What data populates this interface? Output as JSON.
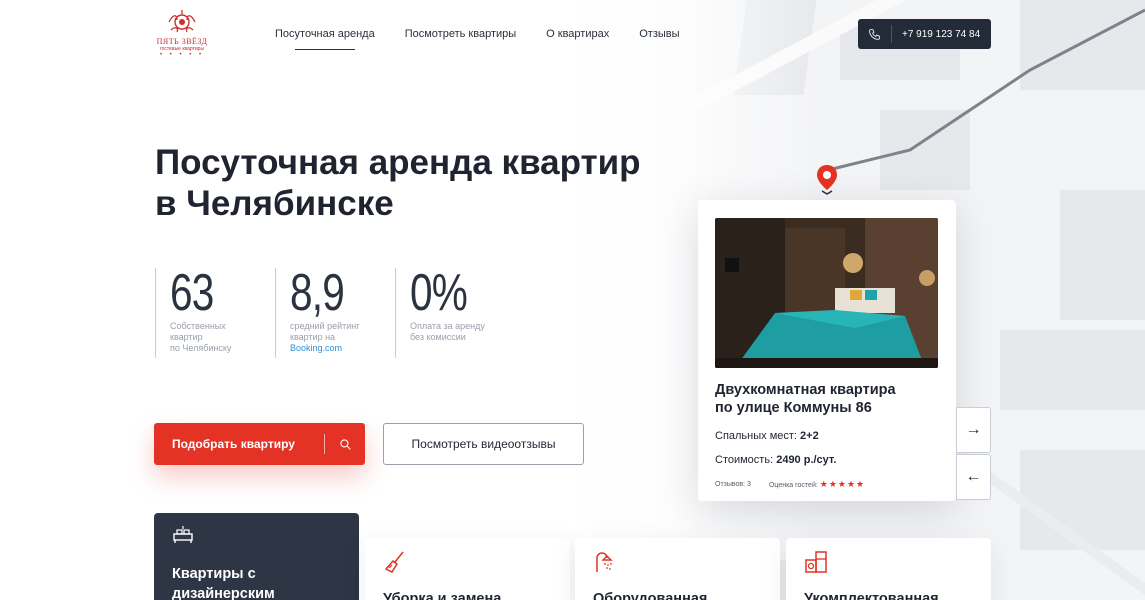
{
  "brand": {
    "name": "ПЯТЬ ЗВЁЗД",
    "tagline": "гостевые квартиры",
    "dots": "• • • • •",
    "accent_color": "#e43324"
  },
  "nav": {
    "items": [
      {
        "label": "Посуточная аренда",
        "active": true
      },
      {
        "label": "Посмотреть квартиры"
      },
      {
        "label": "О квартирах"
      },
      {
        "label": "Отзывы"
      }
    ]
  },
  "header": {
    "phone_icon": "phone-icon",
    "phone": "+7 919 123 74 84"
  },
  "hero": {
    "title_line1": "Посуточная аренда квартир",
    "title_line2": "в Челябинске",
    "stats": [
      {
        "value": "63",
        "caption": [
          "Собственных",
          "квартир",
          "по Челябинску"
        ]
      },
      {
        "value": "8,9",
        "caption": [
          "средний рейтинг",
          "квартир на"
        ],
        "link": "Booking.com"
      },
      {
        "value": "0%",
        "caption": [
          "Оплата за аренду",
          "без комиссии"
        ]
      }
    ],
    "primary_button": "Подобрать квартиру",
    "secondary_button": "Посмотреть видеоотзывы"
  },
  "property": {
    "title_line1": "Двухкомнатная квартира",
    "title_line2": "по улице Коммуны 86",
    "beds_label": "Спальных мест:",
    "beds_value": "2+2",
    "price_label": "Стоимость:",
    "price_value": "2490 р./сут.",
    "reviews": "Отзывов: 3",
    "rating_label": "Оценка гостей:",
    "rating_stars": "★★★★★",
    "rating_value": 5
  },
  "slider": {
    "next": "→",
    "prev": "←"
  },
  "features": [
    {
      "title": "Квартиры с",
      "title2": "дизайнерским",
      "icon": "bed-icon"
    },
    {
      "title": "Уборка и замена",
      "icon": "broom-icon"
    },
    {
      "title": "Оборудованная",
      "icon": "shower-icon"
    },
    {
      "title": "Укомплектованная",
      "icon": "appliances-icon"
    }
  ]
}
